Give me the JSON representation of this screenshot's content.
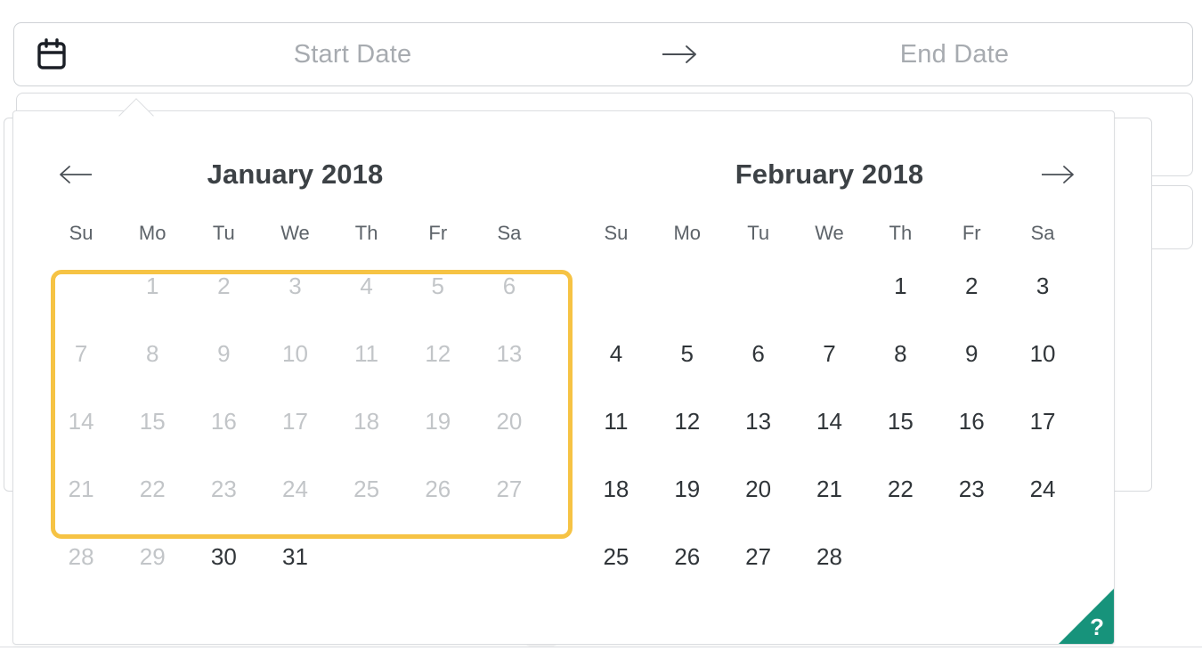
{
  "date_range_input": {
    "calendar_icon": "calendar-icon",
    "start_placeholder": "Start Date",
    "end_placeholder": "End Date",
    "start_value": "",
    "end_value": "",
    "range_arrow_glyph": "→"
  },
  "calendar_popup": {
    "prev_arrow_glyph": "←",
    "next_arrow_glyph": "→",
    "weekdays": [
      "Su",
      "Mo",
      "Tu",
      "We",
      "Th",
      "Fr",
      "Sa"
    ],
    "months": [
      {
        "title": "January 2018",
        "leading_blanks": 1,
        "days": [
          {
            "n": "1",
            "disabled": true
          },
          {
            "n": "2",
            "disabled": true
          },
          {
            "n": "3",
            "disabled": true
          },
          {
            "n": "4",
            "disabled": true
          },
          {
            "n": "5",
            "disabled": true
          },
          {
            "n": "6",
            "disabled": true
          },
          {
            "n": "7",
            "disabled": true
          },
          {
            "n": "8",
            "disabled": true
          },
          {
            "n": "9",
            "disabled": true
          },
          {
            "n": "10",
            "disabled": true
          },
          {
            "n": "11",
            "disabled": true
          },
          {
            "n": "12",
            "disabled": true
          },
          {
            "n": "13",
            "disabled": true
          },
          {
            "n": "14",
            "disabled": true
          },
          {
            "n": "15",
            "disabled": true
          },
          {
            "n": "16",
            "disabled": true
          },
          {
            "n": "17",
            "disabled": true
          },
          {
            "n": "18",
            "disabled": true
          },
          {
            "n": "19",
            "disabled": true
          },
          {
            "n": "20",
            "disabled": true
          },
          {
            "n": "21",
            "disabled": true
          },
          {
            "n": "22",
            "disabled": true
          },
          {
            "n": "23",
            "disabled": true
          },
          {
            "n": "24",
            "disabled": true
          },
          {
            "n": "25",
            "disabled": true
          },
          {
            "n": "26",
            "disabled": true
          },
          {
            "n": "27",
            "disabled": true
          },
          {
            "n": "28",
            "disabled": true
          },
          {
            "n": "29",
            "disabled": true
          },
          {
            "n": "30",
            "disabled": false
          },
          {
            "n": "31",
            "disabled": false
          }
        ]
      },
      {
        "title": "February 2018",
        "leading_blanks": 4,
        "days": [
          {
            "n": "1",
            "disabled": false
          },
          {
            "n": "2",
            "disabled": false
          },
          {
            "n": "3",
            "disabled": false
          },
          {
            "n": "4",
            "disabled": false
          },
          {
            "n": "5",
            "disabled": false
          },
          {
            "n": "6",
            "disabled": false
          },
          {
            "n": "7",
            "disabled": false
          },
          {
            "n": "8",
            "disabled": false
          },
          {
            "n": "9",
            "disabled": false
          },
          {
            "n": "10",
            "disabled": false
          },
          {
            "n": "11",
            "disabled": false
          },
          {
            "n": "12",
            "disabled": false
          },
          {
            "n": "13",
            "disabled": false
          },
          {
            "n": "14",
            "disabled": false
          },
          {
            "n": "15",
            "disabled": false
          },
          {
            "n": "16",
            "disabled": false
          },
          {
            "n": "17",
            "disabled": false
          },
          {
            "n": "18",
            "disabled": false
          },
          {
            "n": "19",
            "disabled": false
          },
          {
            "n": "20",
            "disabled": false
          },
          {
            "n": "21",
            "disabled": false
          },
          {
            "n": "22",
            "disabled": false
          },
          {
            "n": "23",
            "disabled": false
          },
          {
            "n": "24",
            "disabled": false
          },
          {
            "n": "25",
            "disabled": false
          },
          {
            "n": "26",
            "disabled": false
          },
          {
            "n": "27",
            "disabled": false
          },
          {
            "n": "28",
            "disabled": false
          }
        ]
      }
    ]
  },
  "highlight": {
    "label": "disabled-dates-highlight",
    "color": "#F6C344"
  },
  "help_badge": {
    "glyph": "?",
    "color": "#17937B"
  },
  "colors": {
    "highlight_gold": "#F6C344",
    "help_teal": "#17937B",
    "text_dark": "#303539",
    "text_muted": "#c2c5c8",
    "placeholder": "#a7abb0",
    "border": "#dcdee1"
  }
}
